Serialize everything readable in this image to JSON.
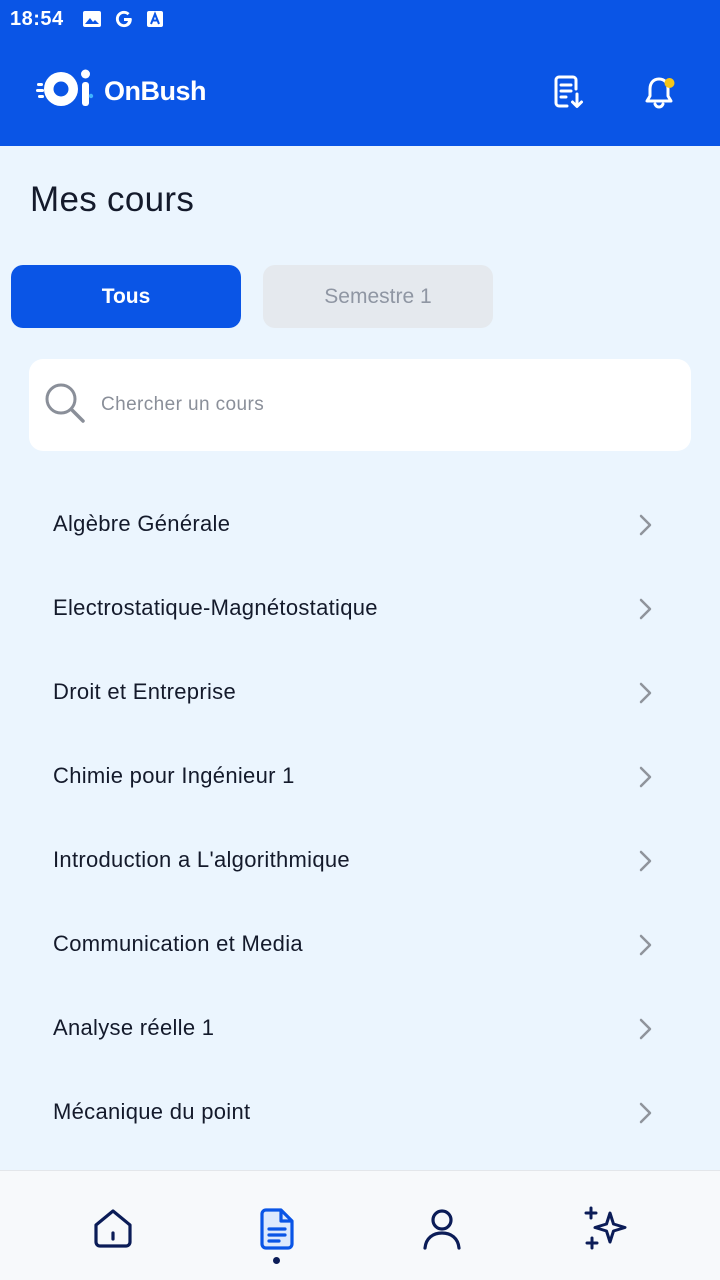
{
  "status_bar": {
    "time": "18:54",
    "icons": [
      "image-icon",
      "google-icon",
      "a-icon"
    ]
  },
  "header": {
    "app_name": "OnBush",
    "icons": [
      "document-download-icon",
      "bell-icon"
    ],
    "notification_dot_color": "#f5c518"
  },
  "page": {
    "title": "Mes cours"
  },
  "tabs": [
    {
      "label": "Tous",
      "active": true
    },
    {
      "label": "Semestre 1",
      "active": false
    }
  ],
  "search": {
    "placeholder": "Chercher un cours",
    "value": ""
  },
  "courses": [
    {
      "label": "Algèbre Générale"
    },
    {
      "label": "Electrostatique-Magnétostatique"
    },
    {
      "label": "Droit et Entreprise"
    },
    {
      "label": "Chimie pour Ingénieur 1"
    },
    {
      "label": "Introduction a L'algorithmique"
    },
    {
      "label": "Communication et Media"
    },
    {
      "label": "Analyse réelle 1"
    },
    {
      "label": "Mécanique du point"
    }
  ],
  "bottom_nav": {
    "items": [
      "home-icon",
      "courses-document-icon",
      "profile-icon",
      "sparkles-icon"
    ],
    "active": "courses-document-icon"
  },
  "colors": {
    "primary": "#0a55e6",
    "background": "#ebf5fe",
    "text": "#141a2b",
    "nav_icon": "#0b1c57"
  }
}
